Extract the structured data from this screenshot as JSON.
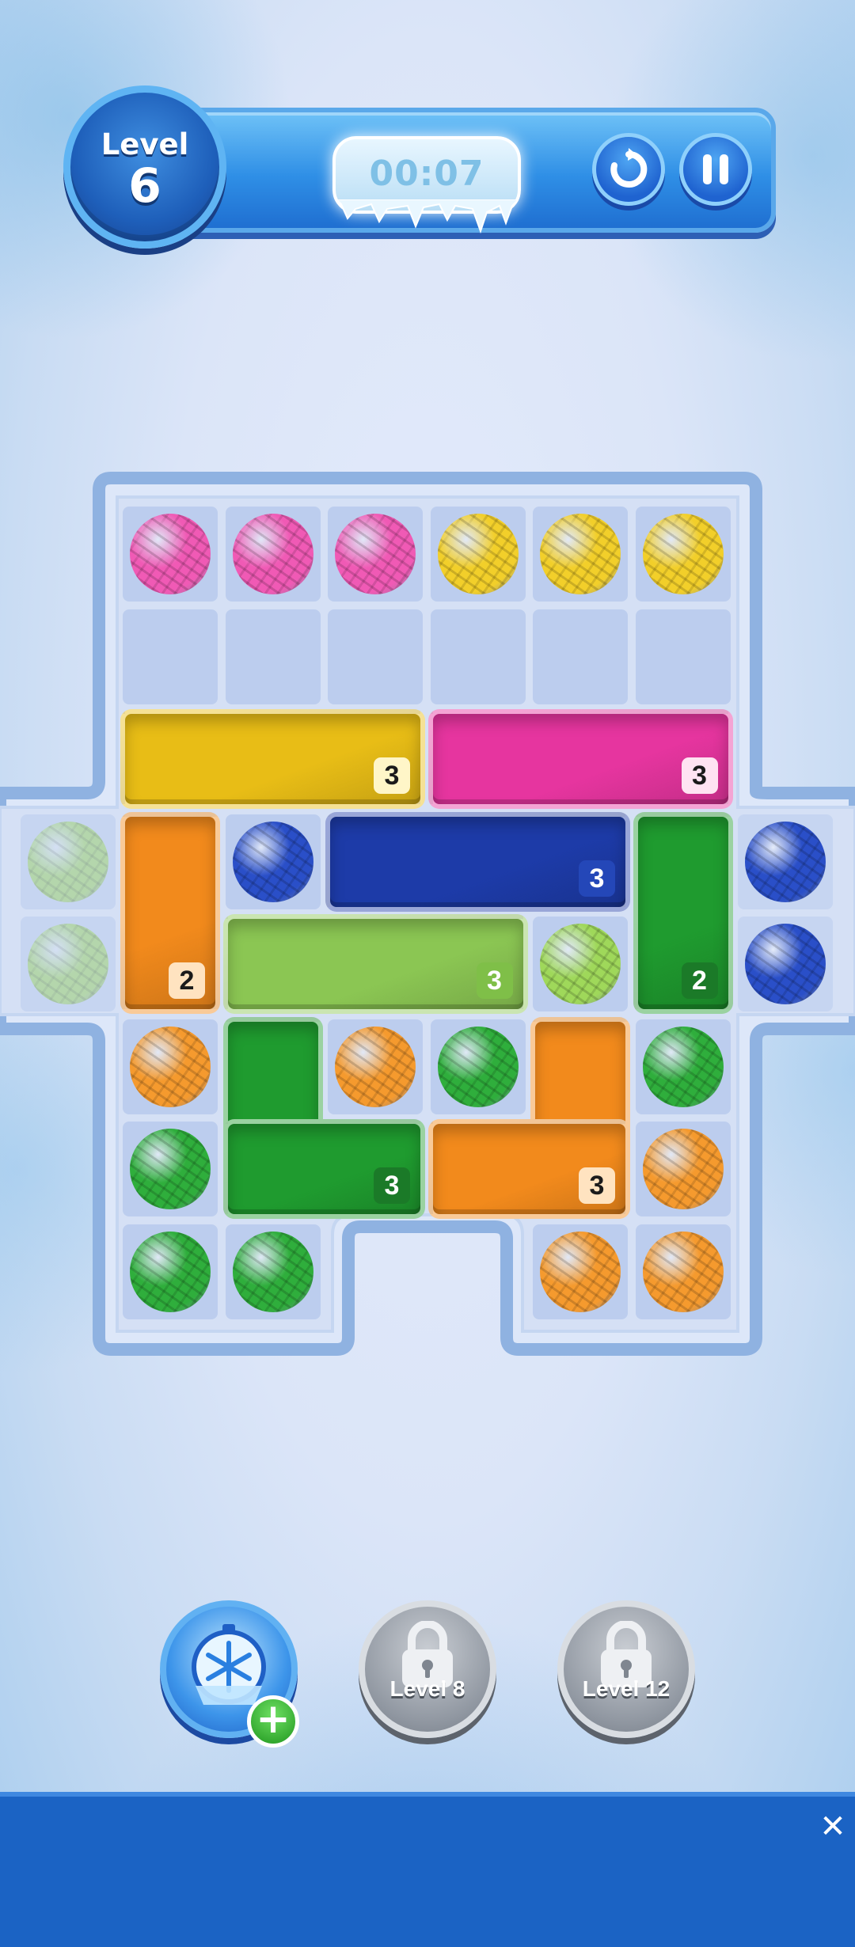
{
  "hud": {
    "level_label": "Level",
    "level_number": "6",
    "timer": "00:07",
    "restart_icon": "restart-icon",
    "pause_icon": "pause-icon"
  },
  "board": {
    "columns": 6,
    "rows": 8,
    "cells": [
      {
        "row": 0,
        "col": 0,
        "ball": "pink"
      },
      {
        "row": 0,
        "col": 1,
        "ball": "pink"
      },
      {
        "row": 0,
        "col": 2,
        "ball": "pink"
      },
      {
        "row": 0,
        "col": 3,
        "ball": "yellow"
      },
      {
        "row": 0,
        "col": 4,
        "ball": "yellow"
      },
      {
        "row": 0,
        "col": 5,
        "ball": "yellow"
      },
      {
        "row": 1,
        "col": 0,
        "ball": null
      },
      {
        "row": 1,
        "col": 1,
        "ball": null
      },
      {
        "row": 1,
        "col": 2,
        "ball": null
      },
      {
        "row": 1,
        "col": 3,
        "ball": null
      },
      {
        "row": 1,
        "col": 4,
        "ball": null
      },
      {
        "row": 1,
        "col": 5,
        "ball": null
      },
      {
        "row": 3,
        "col": 1,
        "ball": "blue"
      },
      {
        "row": 4,
        "col": 4,
        "ball": "lime"
      },
      {
        "row": 5,
        "col": 0,
        "ball": "orange"
      },
      {
        "row": 5,
        "col": 2,
        "ball": "orange"
      },
      {
        "row": 5,
        "col": 3,
        "ball": "green"
      },
      {
        "row": 5,
        "col": 5,
        "ball": "green"
      },
      {
        "row": 6,
        "col": 0,
        "ball": "green"
      },
      {
        "row": 6,
        "col": 5,
        "ball": "orange"
      },
      {
        "row": 7,
        "col": 0,
        "ball": "green"
      },
      {
        "row": 7,
        "col": 1,
        "ball": "green"
      },
      {
        "row": 7,
        "col": 4,
        "ball": "orange"
      },
      {
        "row": 7,
        "col": 5,
        "ball": "orange"
      }
    ],
    "side_balls": [
      {
        "side": "left",
        "row": 3,
        "color": "lime"
      },
      {
        "side": "left",
        "row": 4,
        "color": "lime"
      },
      {
        "side": "right",
        "row": 3,
        "color": "blue"
      },
      {
        "side": "right",
        "row": 4,
        "color": "blue"
      }
    ],
    "blocks": [
      {
        "name": "yellow-block",
        "color": "yellow",
        "count": "3",
        "shape": "bar",
        "row": 2,
        "col": 0,
        "w": 3,
        "h": 1
      },
      {
        "name": "pink-block",
        "color": "pink",
        "count": "3",
        "shape": "bar",
        "row": 2,
        "col": 3,
        "w": 3,
        "h": 1
      },
      {
        "name": "orange-vertical-block",
        "color": "orange",
        "count": "2",
        "shape": "bar",
        "row": 3,
        "col": 0,
        "w": 1,
        "h": 2
      },
      {
        "name": "blue-block",
        "color": "blue",
        "count": "3",
        "shape": "bar",
        "row": 3,
        "col": 2,
        "w": 3,
        "h": 1
      },
      {
        "name": "green-vertical-block",
        "color": "green",
        "count": "2",
        "shape": "bar",
        "row": 3,
        "col": 5,
        "w": 1,
        "h": 2
      },
      {
        "name": "lime-block",
        "color": "lime",
        "count": "3",
        "shape": "bar",
        "row": 4,
        "col": 1,
        "w": 3,
        "h": 1
      },
      {
        "name": "green-l-block",
        "color": "green",
        "count": "3",
        "shape": "L",
        "row": 5,
        "col": 1,
        "w": 2,
        "h": 2
      },
      {
        "name": "orange-l-block",
        "color": "orange",
        "count": "3",
        "shape": "J",
        "row": 5,
        "col": 3,
        "w": 2,
        "h": 2
      }
    ],
    "colors": {
      "pink": "#f05ab5",
      "yellow": "#f2cf2a",
      "blue": "#2a4fc8",
      "lime": "#9fd85a",
      "green": "#2fae3c",
      "orange": "#f59a2e"
    },
    "block_colors": {
      "pink": "#e6359f",
      "yellow": "#e8bd16",
      "blue": "#1d3ba8",
      "lime": "#8bc653",
      "green": "#1f9b2f",
      "orange": "#f28a1c"
    }
  },
  "boosters": [
    {
      "name": "freeze-booster",
      "icon": "snowflake-clock-icon",
      "label": "",
      "locked": false
    },
    {
      "name": "locked-booster-level-8",
      "icon": "lock-icon",
      "label": "Level 8",
      "locked": true
    },
    {
      "name": "locked-booster-level-12",
      "icon": "lock-icon",
      "label": "Level 12",
      "locked": true
    }
  ],
  "ad": {
    "close_label": "✕"
  }
}
